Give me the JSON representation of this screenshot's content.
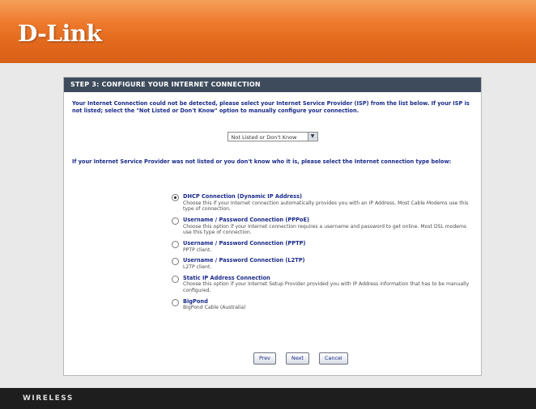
{
  "header": {
    "logo_text": "D-Link",
    "background_color": "#e36a1d"
  },
  "panel": {
    "title": "STEP 3: CONFIGURE YOUR INTERNET CONNECTION",
    "intro": "Your Internet Connection could not be detected, please select your Internet Service Provider (ISP) from the list below. If your ISP is not listed; select the \"Not Listed or Don't Know\" option to manually configure your connection.",
    "isp_select": {
      "selected": "Not Listed or Don't Know"
    },
    "second_intro": "If your Internet Service Provider was not listed or you don't know who it is, please select the Internet connection type below:",
    "options": [
      {
        "title": "DHCP Connection (Dynamic IP Address)",
        "desc": "Choose this if your Internet connection automatically provides you with an IP Address. Most Cable Modems use this type of connection.",
        "checked": true
      },
      {
        "title": "Username / Password Connection (PPPoE)",
        "desc": "Choose this option if your Internet connection requires a username and password to get online. Most DSL modems use this type of connection.",
        "checked": false
      },
      {
        "title": "Username / Password Connection (PPTP)",
        "desc": "PPTP client.",
        "checked": false
      },
      {
        "title": "Username / Password Connection (L2TP)",
        "desc": "L2TP client.",
        "checked": false
      },
      {
        "title": "Static IP Address Connection",
        "desc": "Choose this option if your Internet Setup Provider provided you with IP Address information that has to be manually configured.",
        "checked": false
      },
      {
        "title": "BigPond",
        "desc": "BigPond Cable (Australia)",
        "checked": false
      }
    ],
    "buttons": {
      "prev": "Prev",
      "next": "Next",
      "cancel": "Cancel"
    }
  },
  "footer": {
    "text": "WIRELESS"
  }
}
